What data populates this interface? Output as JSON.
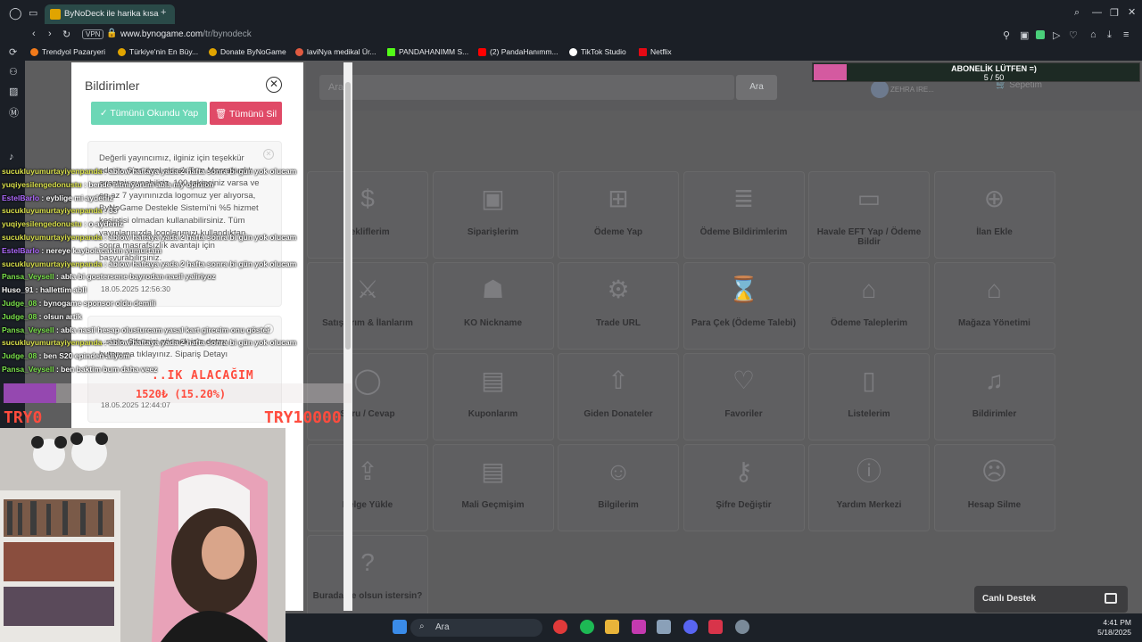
{
  "browser": {
    "tab_title": "ByNoDeck ile harika kısa",
    "vpn_label": "VPN",
    "url_host": "www.bynogame.com",
    "url_path": "/tr/bynodeck",
    "bookmarks": [
      {
        "label": "Trendyol Pazaryeri",
        "icon": "trendyol-icon",
        "color": "#f27a1a"
      },
      {
        "label": "Türkiye'nin En Büy...",
        "icon": "bynogame-icon",
        "color": "#e0a400"
      },
      {
        "label": "Donate ByNoGame",
        "icon": "bynogame-icon",
        "color": "#e0a400"
      },
      {
        "label": "laviNya medikal Ür...",
        "icon": "lavinya-icon",
        "color": "#e05a40"
      },
      {
        "label": "PANDAHANIMM S...",
        "icon": "kick-icon",
        "color": "#53fc18"
      },
      {
        "label": "(2) PandaHanımm...",
        "icon": "youtube-icon",
        "color": "#ff0000"
      },
      {
        "label": "TikTok Studio",
        "icon": "tiktok-icon",
        "color": "#ffffff"
      },
      {
        "label": "Netflix",
        "icon": "netflix-icon",
        "color": "#e50914"
      }
    ]
  },
  "page": {
    "search_placeholder": "Ara...",
    "search_button": "Ara",
    "user_name": "ZEHRA IRE...",
    "cart_label": "Sepetim",
    "grid": [
      {
        "label": "Tekliflerim",
        "icon": "hand-money-icon"
      },
      {
        "label": "Siparişlerim",
        "icon": "box-icon"
      },
      {
        "label": "Ödeme Yap",
        "icon": "folder-add-icon"
      },
      {
        "label": "Ödeme Bildirimlerim",
        "icon": "receipt-icon"
      },
      {
        "label": "Havale EFT Yap / Ödeme Bildir",
        "icon": "card-edit-icon"
      },
      {
        "label": "İlan Ekle",
        "icon": "plus-circle-icon"
      },
      {
        "label": "Satışlarım & İlanlarım",
        "icon": "sword-icon"
      },
      {
        "label": "KO Nickname",
        "icon": "helmet-icon"
      },
      {
        "label": "Trade URL",
        "icon": "steam-icon"
      },
      {
        "label": "Para Çek (Ödeme Talebi)",
        "icon": "money-hourglass-icon"
      },
      {
        "label": "Ödeme Taleplerim",
        "icon": "bank-hourglass-icon"
      },
      {
        "label": "Mağaza Yönetimi",
        "icon": "store-gear-icon"
      },
      {
        "label": "Soru / Cevap",
        "icon": "chat-bubble-icon"
      },
      {
        "label": "Kuponlarım",
        "icon": "gift-icon"
      },
      {
        "label": "Giden Donateler",
        "icon": "arrow-up-circle-icon"
      },
      {
        "label": "Favoriler",
        "icon": "heart-icon"
      },
      {
        "label": "Listelerim",
        "icon": "bookmark-icon"
      },
      {
        "label": "Bildirimler",
        "icon": "bell-icon"
      },
      {
        "label": "Belge Yükle",
        "icon": "file-upload-icon"
      },
      {
        "label": "Mali Geçmişim",
        "icon": "document-icon"
      },
      {
        "label": "Bilgilerim",
        "icon": "user-gear-icon"
      },
      {
        "label": "Şifre Değiştir",
        "icon": "key-icon"
      },
      {
        "label": "Yardım Merkezi",
        "icon": "info-icon"
      },
      {
        "label": "Hesap Silme",
        "icon": "user-remove-icon"
      },
      {
        "label": "Burada ne olsun istersin?",
        "icon": "question-icon"
      }
    ],
    "live_support": "Canlı Destek"
  },
  "notifications": {
    "title": "Bildirimler",
    "mark_all_read": "✓ Tümünü Okundu Yap",
    "delete_all": "🗑 Tümünü Sil",
    "items": [
      {
        "text": "Değerli yayıncımız, ilginiz için teşekkür ederiz. Size özel olarak Tam Masrafsızlık avantajı sunabiliriz. 100 takipçiniz varsa ve en az 7 yayınınızda logomuz yer alıyorsa, ByNoGame Destekle Sistemi'ni %5 hizmet kesintisi olmadan kullanabilirsiniz. Tüm yayınlarınızda logolarımızı kullandıktan sonra masrafsızlık avantajı için başvurabilirsiniz.",
        "date": "18.05.2025 12:56:30"
      },
      {
        "text": "...siniz. Şifrenizi görmek için detay butonuna tıklayınız. Sipariş Detayı",
        "date": "18.05.2025 12:44:07"
      }
    ]
  },
  "overlay": {
    "sub_goal_title": "ABONELİK LÜTFEN =)",
    "sub_goal_count": "5 / 50",
    "sub_goal_progress": 0.1,
    "donation_title": "..IK ALACAĞIM",
    "donation_amount": "1520₺ (15.20%)",
    "donation_progress": 0.152,
    "donation_min": "TRY0",
    "donation_max": "TRY10000",
    "chat": [
      {
        "name": "sucukluyumurtayiyenpanda",
        "msg": "ablow haftaya yada 2 hafta sonra bi gün yok olucam",
        "cls": "y"
      },
      {
        "name": "yuqiyesilengedonustu",
        "msg": "bende istmiyorum abla my opinion",
        "cls": "y"
      },
      {
        "name": "EstelBarlo",
        "msg": "eyblige mi aydeniz",
        "cls": "p"
      },
      {
        "name": "sucukluyumurtayiyenpanda",
        "msg": "33",
        "cls": "y"
      },
      {
        "name": "yuqiyesilengedonustu",
        "msg": "o aydeniz",
        "cls": "y"
      },
      {
        "name": "sucukluyumurtayiyenpanda",
        "msg": "ablow haftaya yada 2 hafta sonra bi gün yok olucam",
        "cls": "y"
      },
      {
        "name": "EstelBarlo",
        "msg": "nereye kaybolacaktın yumurtam",
        "cls": "p"
      },
      {
        "name": "sucukluyumurtayiyenpanda",
        "msg": "ablow haftaya yada 2 hafta sonra bi gün yok olucam",
        "cls": "y"
      },
      {
        "name": "Pansa_Veysell",
        "msg": "abla bi gostersene bayrodan nasil yaliriyoz",
        "cls": ""
      },
      {
        "name": "Huso_91",
        "msg": "hallettim abll",
        "cls": "w"
      },
      {
        "name": "Judge_08",
        "msg": "bynogame sponsor oldu demili",
        "cls": ""
      },
      {
        "name": "Judge_08",
        "msg": "olsun artik",
        "cls": ""
      },
      {
        "name": "Pansa_Veysell",
        "msg": "abla nasil hesap olusturcam yasal kart girceim onu göster",
        "cls": ""
      },
      {
        "name": "sucukluyumurtayiyenpanda",
        "msg": "ablow haftaya yada 2 hafta sonra bi gün yok olucam",
        "cls": "y"
      },
      {
        "name": "Judge_08",
        "msg": "ben S20 epinden aliyom",
        "cls": ""
      },
      {
        "name": "Pansa_Veysell",
        "msg": "ben baktim bum daha veez",
        "cls": ""
      }
    ]
  },
  "taskbar": {
    "search_label": "Ara",
    "time": "4:41 PM",
    "date": "5/18/2025"
  }
}
